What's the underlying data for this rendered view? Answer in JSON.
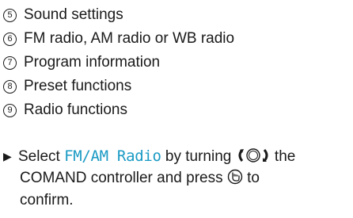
{
  "legend": [
    {
      "number": "5",
      "text": "Sound settings"
    },
    {
      "number": "6",
      "text": "FM radio, AM radio or WB radio"
    },
    {
      "number": "7",
      "text": "Program information"
    },
    {
      "number": "8",
      "text": "Preset functions"
    },
    {
      "number": "9",
      "text": "Radio functions"
    }
  ],
  "instruction": {
    "bullet_icon": "triangle-bullet-icon",
    "part1": "Select",
    "menu_term": "FM/AM Radio",
    "part2": "by turning",
    "turn_icon": "controller-turn-icon",
    "part3": "the",
    "line2_part1": "COMAND controller and press",
    "press_icon": "controller-press-icon",
    "line2_part2": "to",
    "line3": "confirm.",
    "menu_term_color": "#1a9ac4"
  }
}
